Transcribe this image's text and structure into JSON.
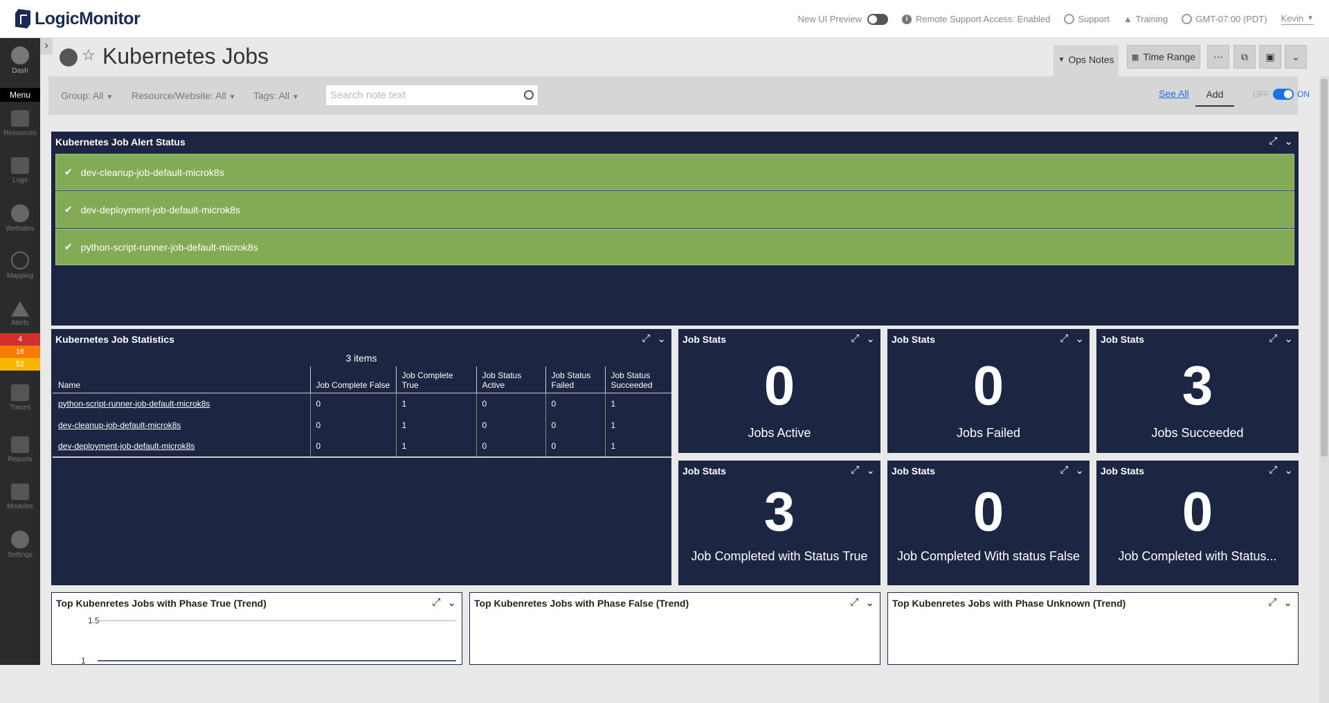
{
  "topbar": {
    "logo": "LogicMonitor",
    "new_ui_preview": "New UI Preview",
    "remote_support": "Remote Support Access: Enabled",
    "support": "Support",
    "training": "Training",
    "timezone": "GMT-07:00 (PDT)",
    "user": "Kevin"
  },
  "sidebar": {
    "dash": "Dash",
    "menu": "Menu",
    "resources": "Resources",
    "logs": "Logs",
    "websites": "Websites",
    "mapping": "Mapping",
    "alerts": "Alerts",
    "alert_counts": [
      "4",
      "16",
      "52"
    ],
    "traces": "Traces",
    "reports": "Reports",
    "modules": "Modules",
    "settings": "Settings"
  },
  "page": {
    "title": "Kubernetes Jobs",
    "ops_notes": "Ops Notes",
    "time_range": "Time Range"
  },
  "notes": {
    "group": "Group: All",
    "resource": "Resource/Website: All",
    "tags": "Tags: All",
    "search_placeholder": "Search note text",
    "see_all": "See All",
    "add": "Add",
    "off": "OFF",
    "on": "ON"
  },
  "alert_widget": {
    "title": "Kubernetes Job Alert Status",
    "rows": [
      "dev-cleanup-job-default-microk8s",
      "dev-deployment-job-default-microk8s",
      "python-script-runner-job-default-microk8s"
    ]
  },
  "stats_table": {
    "title": "Kubernetes Job Statistics",
    "count": "3 items",
    "headers": [
      "Name",
      "Job Complete False",
      "Job Complete True",
      "Job Status Active",
      "Job Status Failed",
      "Job Status Succeeded"
    ],
    "rows": [
      [
        "python-script-runner-job-default-microk8s",
        "0",
        "1",
        "0",
        "0",
        "1"
      ],
      [
        "dev-cleanup-job-default-microk8s",
        "0",
        "1",
        "0",
        "0",
        "1"
      ],
      [
        "dev-deployment-job-default-microk8s",
        "0",
        "1",
        "0",
        "0",
        "1"
      ]
    ]
  },
  "job_stats": [
    {
      "title": "Job Stats",
      "value": "0",
      "label": "Jobs Active"
    },
    {
      "title": "Job Stats",
      "value": "0",
      "label": "Jobs Failed"
    },
    {
      "title": "Job Stats",
      "value": "3",
      "label": "Jobs Succeeded"
    },
    {
      "title": "Job Stats",
      "value": "3",
      "label": "Job Completed with Status True"
    },
    {
      "title": "Job Stats",
      "value": "0",
      "label": "Job Completed With status False"
    },
    {
      "title": "Job Stats",
      "value": "0",
      "label": "Job Completed with Status..."
    }
  ],
  "trends": [
    {
      "title": "Top Kubenretes Jobs with Phase True (Trend)",
      "ticks": [
        "1.5",
        "1"
      ]
    },
    {
      "title": "Top Kubenretes Jobs with Phase False (Trend)"
    },
    {
      "title": "Top Kubenretes Jobs with Phase Unknown (Trend)"
    }
  ],
  "colors": {
    "widget_bg": "#1c2541",
    "alert_ok": "#83ab55",
    "link": "#1a73e8"
  }
}
